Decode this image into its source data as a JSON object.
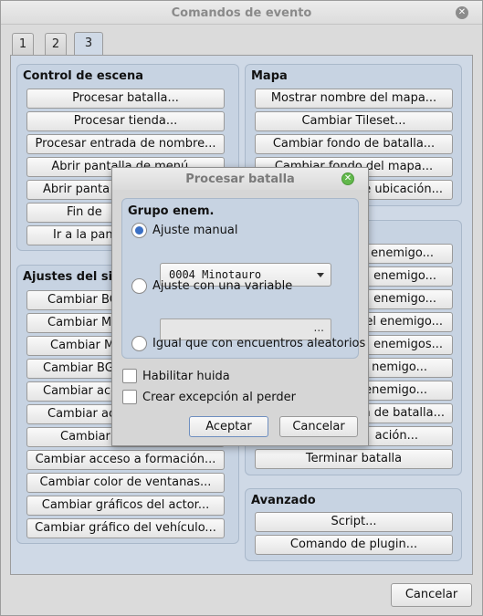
{
  "window": {
    "title": "Comandos de evento"
  },
  "tabs": [
    "1",
    "2",
    "3"
  ],
  "active_tab": "3",
  "scene_control": {
    "title": "Control de escena",
    "buttons": [
      "Procesar batalla...",
      "Procesar tienda...",
      "Procesar entrada de nombre...",
      "Abrir pantalla de menú...",
      "Abrir panta",
      "Fin de",
      "Ir a la pan"
    ]
  },
  "map": {
    "title": "Mapa",
    "buttons": [
      "Mostrar nombre del mapa...",
      "Cambiar Tileset...",
      "Cambiar fondo de batalla...",
      "Cambiar fondo del mapa...",
      "e ubicación..."
    ]
  },
  "system_settings": {
    "title": "Ajustes del si",
    "buttons": [
      "Cambiar BG",
      "Cambiar M",
      "Cambiar M",
      "Cambiar BG",
      "Cambiar acc",
      "Cambiar ac",
      "Cambiar",
      "Cambiar acceso a formación...",
      "Cambiar color de ventanas...",
      "Cambiar gráficos del actor...",
      "Cambiar gráfico del vehículo..."
    ]
  },
  "battle": {
    "buttons": [
      "enemigo...",
      "enemigo...",
      "enemigo...",
      "el enemigo...",
      "enemigos...",
      "nemigo...",
      "enemigo...",
      "n de batalla...",
      "ación...",
      "Terminar batalla"
    ]
  },
  "advanced": {
    "title": "Avanzado",
    "buttons": [
      "Script...",
      "Comando de plugin..."
    ]
  },
  "footer": {
    "cancel_label": "Cancelar"
  },
  "dialog": {
    "title": "Procesar batalla",
    "group_title": "Grupo enem.",
    "option_manual": "Ajuste manual",
    "troop_selected": "0004 Minotauro",
    "option_variable": "Ajuste con una variable",
    "variable_button": "...",
    "option_random": "Igual que con encuentros aleatorios",
    "selected_option": "manual",
    "can_escape_label": "Habilitar huida",
    "can_escape": false,
    "can_lose_label": "Crear excepción al perder",
    "can_lose": false,
    "ok_label": "Aceptar",
    "cancel_label": "Cancelar"
  }
}
